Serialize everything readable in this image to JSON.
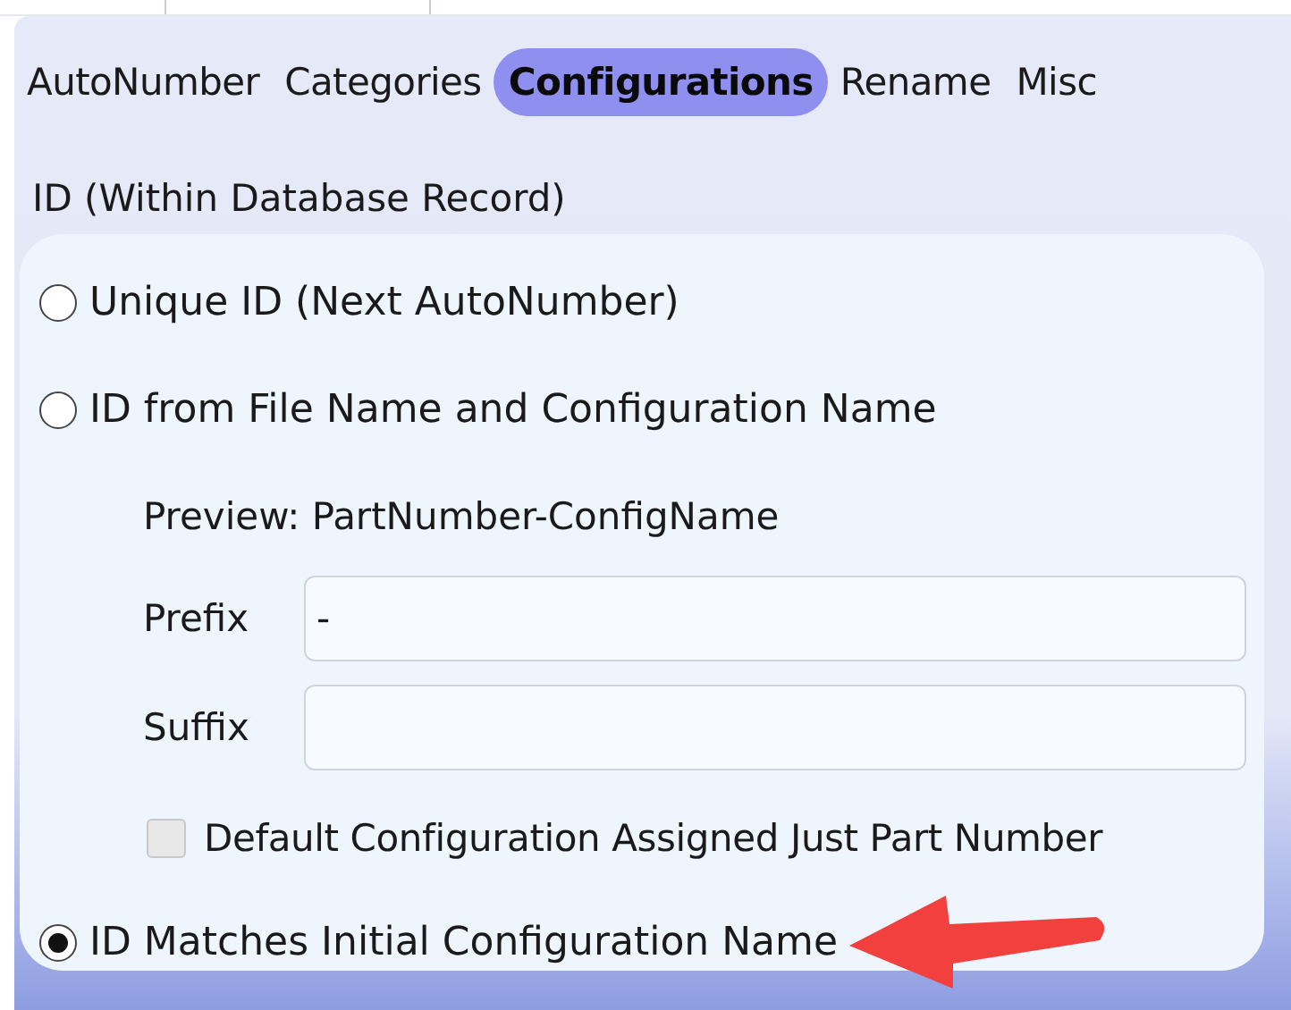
{
  "tabs": [
    {
      "label": "AutoNumber",
      "selected": false
    },
    {
      "label": "Categories",
      "selected": false
    },
    {
      "label": "Configurations",
      "selected": true
    },
    {
      "label": "Rename",
      "selected": false
    },
    {
      "label": "Misc",
      "selected": false
    }
  ],
  "group": {
    "label": "ID (Within Database Record)",
    "options": [
      {
        "label": "Unique ID (Next AutoNumber)",
        "selected": false
      },
      {
        "label": "ID from File Name and Configuration Name",
        "selected": false,
        "details": {
          "preview": "Preview: PartNumber-ConfigName",
          "fields": [
            {
              "label": "Prefix",
              "value": "-"
            },
            {
              "label": "Suffix"
            }
          ],
          "checkbox": {
            "label": "Default Configuration Assigned Just Part Number",
            "checked": false,
            "disabled": true
          }
        }
      },
      {
        "label": "ID Matches Initial Configuration Name",
        "selected": true,
        "annotated": true
      }
    ]
  }
}
